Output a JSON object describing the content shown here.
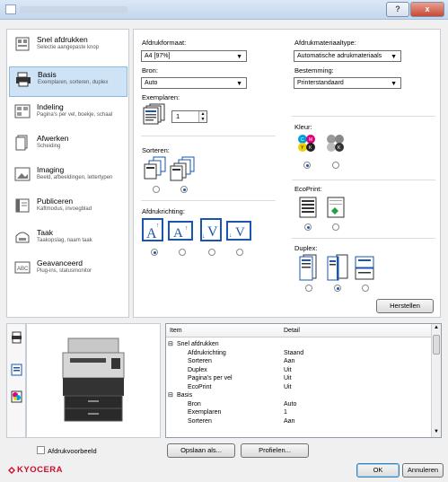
{
  "window": {
    "help_glyph": "?",
    "close_glyph": "x"
  },
  "sidebar": {
    "items": [
      {
        "title": "Snel afdrukken",
        "subtitle": "Selectie aangepaste knop",
        "icon": "quick-print-icon"
      },
      {
        "title": "Basis",
        "subtitle": "Exemplaren, sorteren, duplex",
        "icon": "printer-icon"
      },
      {
        "title": "Indeling",
        "subtitle": "Pagina's per vel, boekje, schaal",
        "icon": "layout-icon"
      },
      {
        "title": "Afwerken",
        "subtitle": "Scheiding",
        "icon": "finishing-icon"
      },
      {
        "title": "Imaging",
        "subtitle": "Beeld, afbeeldingen, lettertypen",
        "icon": "imaging-icon"
      },
      {
        "title": "Publiceren",
        "subtitle": "Kaftmodus, invoegblad",
        "icon": "publishing-icon"
      },
      {
        "title": "Taak",
        "subtitle": "Taakopslag, naam taak",
        "icon": "job-icon"
      },
      {
        "title": "Geavanceerd",
        "subtitle": "Plug-ins, statusmonitor",
        "icon": "advanced-icon"
      }
    ],
    "selected": "Basis"
  },
  "basic": {
    "paper_size_label": "Afdrukformaat:",
    "paper_size_value": "A4 [97%]",
    "source_label": "Bron:",
    "source_value": "Auto",
    "copies_label": "Exemplaren:",
    "copies_value": "1",
    "collate_label": "Sorteren:",
    "orientation_label": "Afdrukrichting:",
    "media_type_label": "Afdrukmateriaaltype:",
    "media_type_value": "Automatische adrukmateriaals",
    "destination_label": "Bestemming:",
    "destination_value": "Printerstandaard",
    "color_label": "Kleur:",
    "ecoprint_label": "EcoPrint:",
    "duplex_label": "Duplex:",
    "reset_button": "Herstellen"
  },
  "summary_table": {
    "headers": [
      "Item",
      "Detail"
    ],
    "rows": [
      {
        "indent": 0,
        "item": "Snel afdrukken",
        "detail": "",
        "group": true
      },
      {
        "indent": 1,
        "item": "Afdrukrichting",
        "detail": "Staand"
      },
      {
        "indent": 1,
        "item": "Sorteren",
        "detail": "Aan"
      },
      {
        "indent": 1,
        "item": "Duplex",
        "detail": "Uit"
      },
      {
        "indent": 1,
        "item": "Pagina's per vel",
        "detail": "Uit"
      },
      {
        "indent": 1,
        "item": "EcoPrint",
        "detail": "Uit"
      },
      {
        "indent": 0,
        "item": "Basis",
        "detail": "",
        "group": true
      },
      {
        "indent": 1,
        "item": "Bron",
        "detail": "Auto"
      },
      {
        "indent": 1,
        "item": "Exemplaren",
        "detail": "1"
      },
      {
        "indent": 1,
        "item": "Sorteren",
        "detail": "Aan"
      }
    ]
  },
  "bottom": {
    "preview_checkbox_label": "Afdrukvoorbeeld",
    "save_as_button": "Opslaan als...",
    "profiles_button": "Profielen...",
    "ok_button": "OK",
    "cancel_button": "Annuleren",
    "brand": "KYOCERA"
  },
  "colors": {
    "brand_red": "#c8102e",
    "selection_blue": "#cfe3f7",
    "accent_blue": "#1a56b0"
  }
}
